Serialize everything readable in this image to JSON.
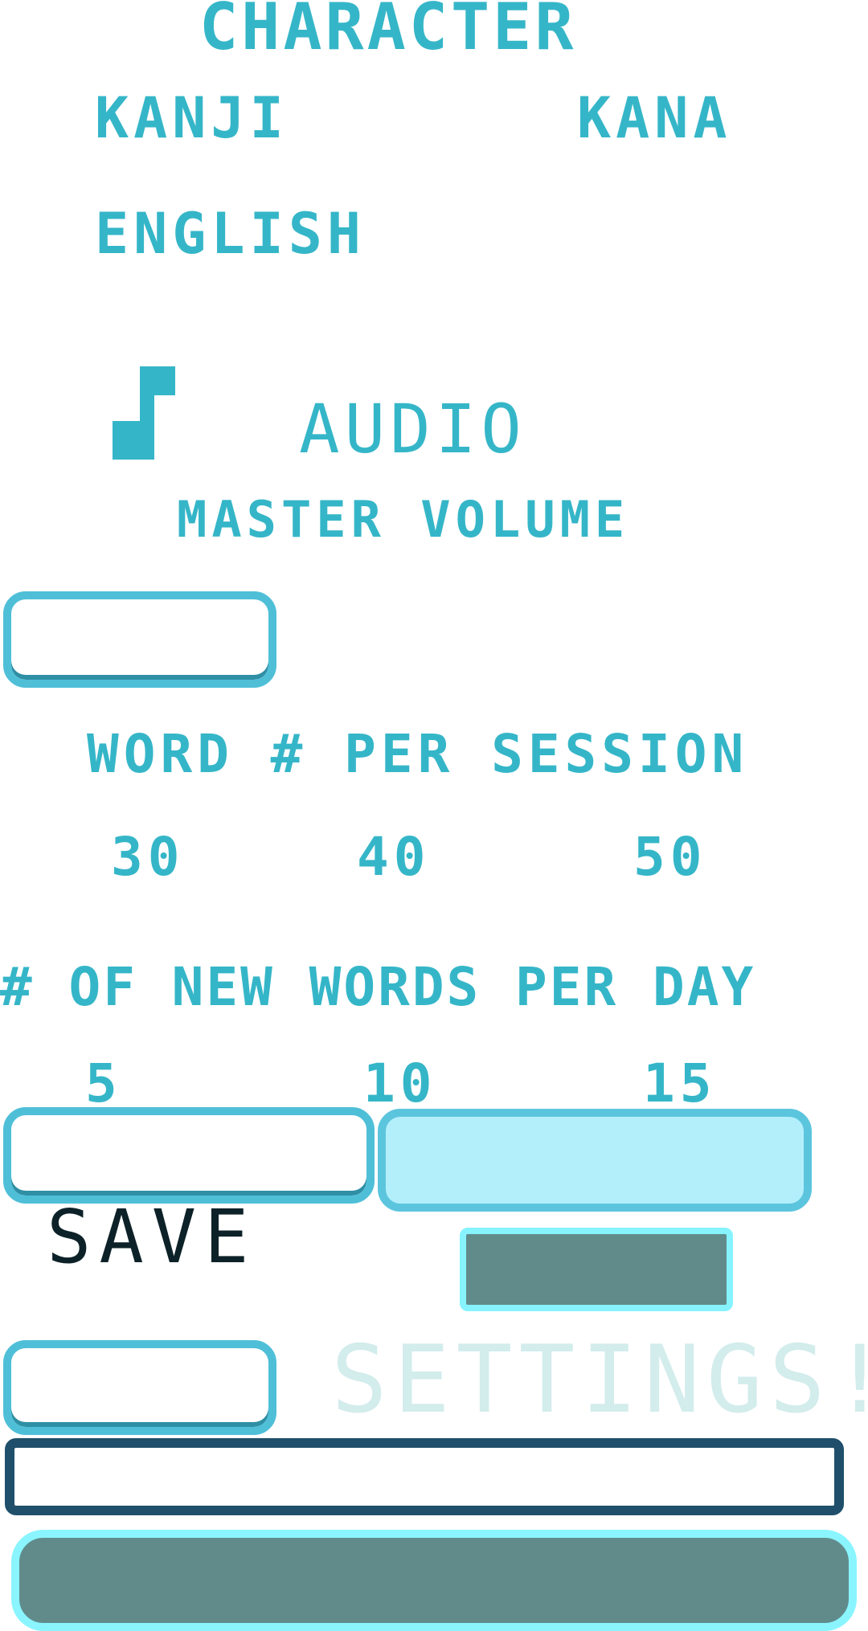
{
  "character": {
    "title": "CHARACTER",
    "options": [
      "KANJI",
      "KANA",
      "ENGLISH"
    ]
  },
  "audio": {
    "icon": "music-note-icon",
    "title": "AUDIO",
    "master_volume_label": "MASTER VOLUME"
  },
  "words_per_session": {
    "title": "WORD # PER  SESSION",
    "options": [
      "30",
      "40",
      "50"
    ]
  },
  "new_words_per_day": {
    "title": "# OF NEW WORDS PER DAY",
    "options": [
      "5",
      "10",
      "15"
    ],
    "selected": "15"
  },
  "save": {
    "label": "SAVE"
  },
  "notice": {
    "text": "SETTINGS!"
  },
  "colors": {
    "accent": "#35b6c8",
    "button_fill": "#618b8b",
    "button_glow": "#86f3ff",
    "selected_fill": "#b3effb",
    "track_border": "#1f4f6b",
    "save_text": "#0d2228",
    "notice_text": "#d3ecec"
  }
}
